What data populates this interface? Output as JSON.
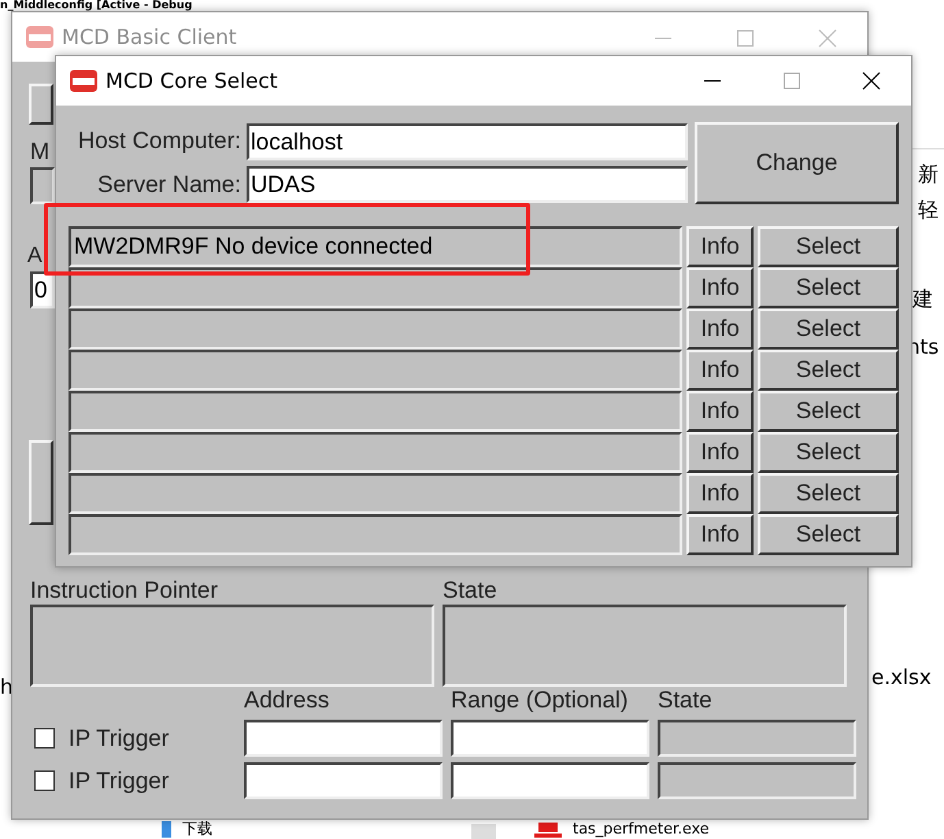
{
  "background": {
    "title_text": "n_Middleconfig [Active - Debug",
    "fragments": [
      "新",
      "轻",
      "建",
      "nts",
      "h",
      "e.xlsx"
    ],
    "files": [
      {
        "name": "下载",
        "kind": "folder"
      },
      {
        "name": "tas_perfmeter.exe",
        "kind": "app"
      }
    ]
  },
  "basic_client": {
    "title": "MCD Basic Client",
    "labels": [
      "M",
      "A"
    ],
    "address_value": "0",
    "instruction_pointer_label": "Instruction Pointer",
    "state_label": "State",
    "trigger_columns": [
      "Address",
      "Range (Optional)",
      "State"
    ],
    "triggers": [
      {
        "label": "IP Trigger",
        "checked": false
      },
      {
        "label": "IP Trigger",
        "checked": false
      }
    ]
  },
  "core_select": {
    "title": "MCD Core Select",
    "host_label": "Host Computer:",
    "host_value": "localhost",
    "server_label": "Server Name:",
    "server_value": "UDAS",
    "change_button": "Change",
    "devices": [
      {
        "text": "MW2DMR9F No device connected",
        "info": "Info",
        "select": "Select"
      },
      {
        "info": "Info",
        "select": "Select"
      },
      {
        "info": "Info",
        "select": "Select"
      },
      {
        "info": "Info",
        "select": "Select"
      },
      {
        "info": "Info",
        "select": "Select"
      },
      {
        "info": "Info",
        "select": "Select"
      },
      {
        "info": "Info",
        "select": "Select"
      },
      {
        "info": "Info",
        "select": "Select"
      }
    ]
  }
}
